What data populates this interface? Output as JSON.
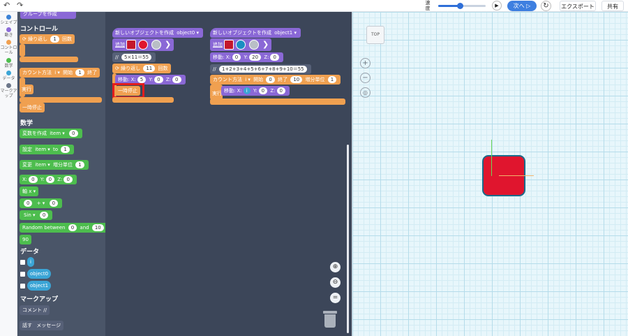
{
  "topbar": {
    "undo_icon": "undo-arrow",
    "redo_icon": "redo-arrow",
    "speed_label": "速度",
    "speed_value": 0.45,
    "play_icon": "play",
    "next_label": "次へ ▷",
    "reset_icon": "reset",
    "export_label": "エクスポート",
    "share_label": "共有"
  },
  "categories": [
    {
      "label": "シェイプ",
      "color": "#3b82d6"
    },
    {
      "label": "動き",
      "color": "#8b6bd8"
    },
    {
      "label": "コントロール",
      "color": "#f0a050"
    },
    {
      "label": "数学",
      "color": "#4dbd4e"
    },
    {
      "label": "データ",
      "color": "#3ba5d6"
    },
    {
      "label": "マークアップ",
      "color": "#6c7689"
    }
  ],
  "palette": {
    "top_block": "グループを作成",
    "control_title": "コントロール",
    "repeat_label": "繰り返し",
    "repeat_count": "1",
    "repeat_unit": "回数",
    "count_label": "カウント方法",
    "count_var": "i",
    "count_start_label": "開始",
    "count_start": "1",
    "count_end_label": "終了",
    "exec_label": "実行",
    "pause_label": "一時停止",
    "math_title": "数学",
    "make_var_label": "変数を作成",
    "make_var_name": "item",
    "make_var_value": "0",
    "set_label": "設定",
    "set_var": "item",
    "set_to": "to",
    "set_value": "1",
    "change_label": "変更",
    "change_var": "item",
    "change_by": "増分単位",
    "change_value": "1",
    "xyz": {
      "x_label": "X:",
      "x": "0",
      "y_label": "Y:",
      "y": "0",
      "z_label": "Z:",
      "z": "0"
    },
    "axis_label": "軸 x",
    "op_left": "0",
    "op": "+",
    "op_right": "0",
    "sin_label": "Sin",
    "sin_value": "0",
    "random_label": "Random between",
    "random_min": "0",
    "random_and": "and",
    "random_max": "10",
    "number_value": "90",
    "data_title": "データ",
    "data_items": [
      "i",
      "object0",
      "object1"
    ],
    "markup_title": "マークアップ",
    "comment_label": "コメント //",
    "say_label": "話す",
    "say_message": "メッセージ"
  },
  "workspace": {
    "stack1": {
      "create_label": "新しいオブジェクトを作成",
      "object_name": "object0",
      "add_label": "追加",
      "color_main": "#e0152e",
      "comment_prefix": "//",
      "comment": "5×11＝55",
      "repeat_label": "繰り返し",
      "repeat_count": "11",
      "repeat_unit": "回数",
      "move_label": "移動:",
      "x_label": "X:",
      "x": "5",
      "y_label": "Y:",
      "y": "0",
      "z_label": "Z:",
      "z": "0",
      "pause_label": "一時停止"
    },
    "stack2": {
      "create_label": "新しいオブジェクトを作成",
      "object_name": "object1",
      "add_label": "追加",
      "color_main": "#1b8ec2",
      "move_label": "移動:",
      "x_label": "X:",
      "x": "0",
      "y_label": "Y:",
      "y": "20",
      "z_label": "Z:",
      "z": "0",
      "comment_prefix": "//",
      "comment": "1+2+3+4+5+6+7+8+9+10＝55",
      "count_label": "カウント方法",
      "count_var": "i",
      "start_label": "開始",
      "start": "0",
      "end_label": "終了",
      "end": "10",
      "step_label": "増分単位",
      "step": "1",
      "exec_label": "実行",
      "inner_move_label": "移動:",
      "inner_x_label": "X:",
      "inner_x": "i",
      "inner_y_label": "Y:",
      "inner_y": "0",
      "inner_z_label": "Z:",
      "inner_z": "0"
    },
    "zoom_in_icon": "zoom-in",
    "zoom_out_icon": "zoom-out",
    "center_icon": "center",
    "trash_icon": "trash"
  },
  "stage": {
    "top_view_label": "TOP",
    "object_color": "#e0152e",
    "grid_color": "#b5dcea"
  }
}
